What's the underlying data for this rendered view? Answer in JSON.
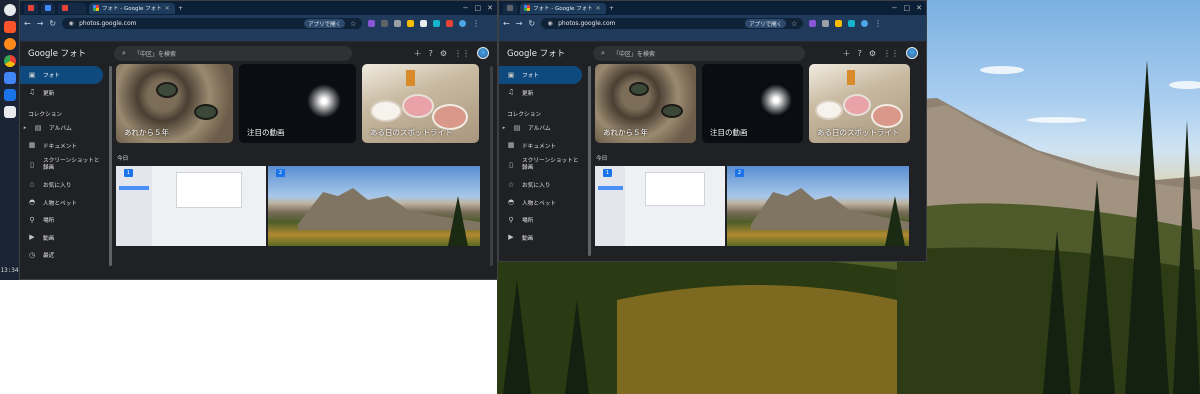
{
  "shelf": {
    "time": "13:34",
    "icons": [
      "launcher-icon",
      "brave-icon",
      "firefox-icon",
      "chrome-icon",
      "files-icon",
      "store-icon",
      "docs-icon"
    ]
  },
  "browser": {
    "tab_title": "フォト - Google フォト",
    "url": "photos.google.com",
    "open_app_label": "アプリで開く",
    "win_controls": [
      "−",
      "□",
      "✕"
    ]
  },
  "photos": {
    "logo": "Google フォト",
    "search_placeholder": "「中区」を検索",
    "sidebar": {
      "items": [
        {
          "label": "フォト",
          "icon": "photo-icon",
          "active": true
        },
        {
          "label": "更新",
          "icon": "bell-icon",
          "active": false
        }
      ],
      "collection_heading": "コレクション",
      "collection_items": [
        {
          "label": "アルバム",
          "icon": "album-icon"
        },
        {
          "label": "ドキュメント",
          "icon": "document-icon"
        },
        {
          "label": "スクリーンショットと録画",
          "icon": "screenshot-icon"
        },
        {
          "label": "お気に入り",
          "icon": "star-icon"
        },
        {
          "label": "人物とペット",
          "icon": "people-icon"
        },
        {
          "label": "場所",
          "icon": "place-icon"
        },
        {
          "label": "動画",
          "icon": "video-icon"
        },
        {
          "label": "最近",
          "icon": "recent-icon"
        }
      ]
    },
    "cards": [
      {
        "label": "あれから５年",
        "kind": "cat"
      },
      {
        "label": "注目の動画",
        "kind": "fireworks"
      },
      {
        "label": "ある日のスポットライト",
        "kind": "food"
      }
    ],
    "today_label": "今日",
    "tiles": [
      {
        "badge": "1",
        "kind": "screenshot"
      },
      {
        "badge": "2",
        "kind": "mountain"
      }
    ]
  },
  "colors": {
    "accent": "#0e4a7e",
    "browser_frame": "#1f3a5a",
    "app_bg": "#202124"
  }
}
